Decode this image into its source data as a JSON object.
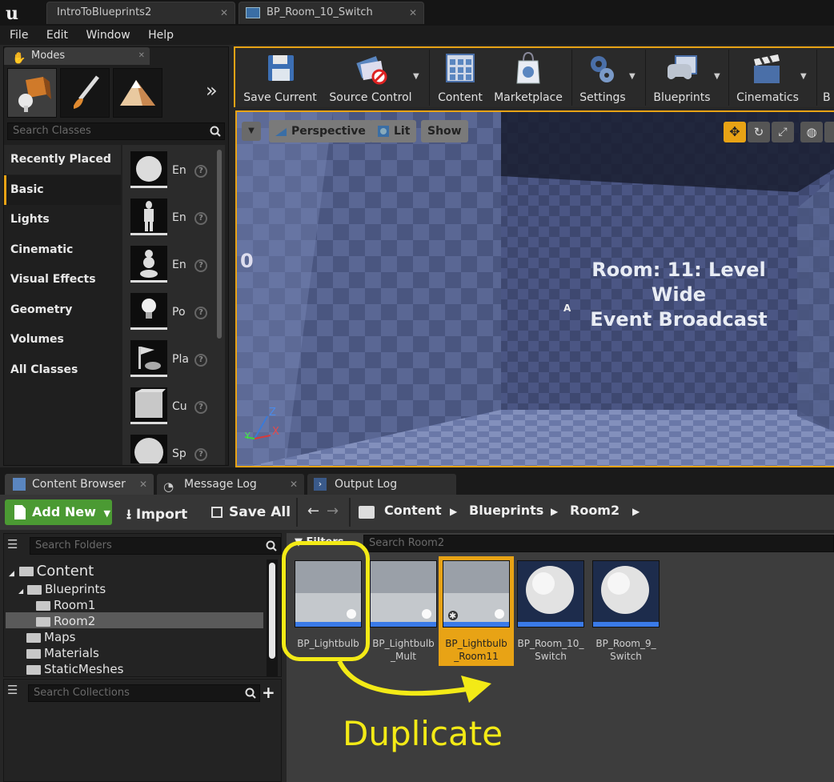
{
  "titlebar": {
    "tab1": "IntroToBlueprints2",
    "tab2": "BP_Room_10_Switch"
  },
  "menu": [
    "File",
    "Edit",
    "Window",
    "Help"
  ],
  "modes": {
    "title": "Modes",
    "search_placeholder": "Search Classes",
    "categories": [
      "Recently Placed",
      "Basic",
      "Lights",
      "Cinematic",
      "Visual Effects",
      "Geometry",
      "Volumes",
      "All Classes"
    ],
    "selected_category": "Basic",
    "items": [
      "En",
      "En",
      "En",
      "Po",
      "Pla",
      "Cu",
      "Sp"
    ]
  },
  "toolbar": {
    "buttons": [
      "Save Current",
      "Source Control",
      "Content",
      "Marketplace",
      "Settings",
      "Blueprints",
      "Cinematics"
    ],
    "overflow": "B"
  },
  "viewport": {
    "perspective": "Perspective",
    "lit": "Lit",
    "show": "Show",
    "room_line1": "Room: 11: Level Wide",
    "room_line2": "Event Broadcast",
    "left_text": "0",
    "marker": "A",
    "axis_z": "Z",
    "axis_x": "X",
    "axis_y": "Y"
  },
  "bottom_tabs": [
    "Content Browser",
    "Message Log",
    "Output Log"
  ],
  "content_browser": {
    "add_new": "Add New",
    "import": "Import",
    "save_all": "Save All",
    "breadcrumb": [
      "Content",
      "Blueprints",
      "Room2"
    ],
    "search_folders": "Search Folders",
    "filters": "Filters",
    "search_assets": "Search Room2",
    "search_collections": "Search Collections",
    "tree": [
      "Content",
      "Blueprints",
      "Room1",
      "Room2",
      "Maps",
      "Materials",
      "StaticMeshes"
    ],
    "selected_folder": "Room2",
    "assets": [
      {
        "line1": "BP_Lightbulb",
        "line2": ""
      },
      {
        "line1": "BP_Lightbulb",
        "line2": "_Mult"
      },
      {
        "line1": "BP_Lightbulb",
        "line2": "_Room11"
      },
      {
        "line1": "BP_Room_10_",
        "line2": "Switch"
      },
      {
        "line1": "BP_Room_9_",
        "line2": "Switch"
      }
    ],
    "selected_asset": "BP_Lightbulb_Room11"
  },
  "annotation": {
    "text": "Duplicate",
    "color": "#f3ea16"
  },
  "colors": {
    "accent": "#e8a315",
    "add_new": "#4b9a33",
    "annotation": "#f3ea16"
  }
}
